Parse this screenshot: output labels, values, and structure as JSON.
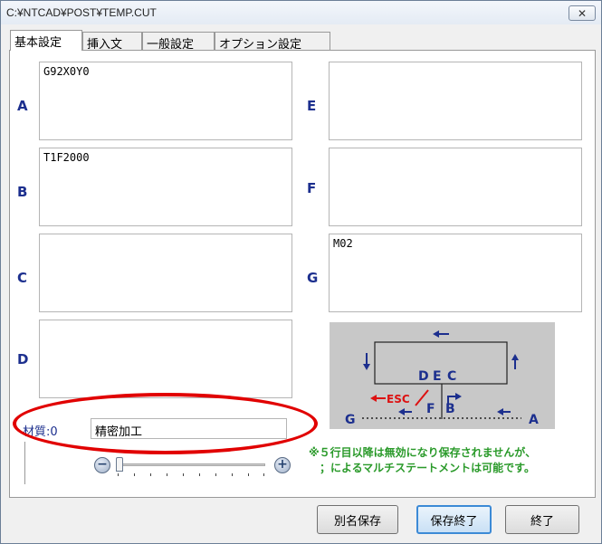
{
  "window": {
    "title": "C:¥NTCAD¥POST¥TEMP.CUT",
    "close_label": "✕"
  },
  "tabs": [
    {
      "label": "基本設定"
    },
    {
      "label": "挿入文"
    },
    {
      "label": "一般設定"
    },
    {
      "label": "オプション設定"
    }
  ],
  "slots": {
    "A": {
      "label": "A",
      "value": "G92X0Y0"
    },
    "B": {
      "label": "B",
      "value": "T1F2000"
    },
    "C": {
      "label": "C",
      "value": ""
    },
    "D": {
      "label": "D",
      "value": ""
    },
    "E": {
      "label": "E",
      "value": ""
    },
    "F": {
      "label": "F",
      "value": ""
    },
    "G": {
      "label": "G",
      "value": "M02"
    }
  },
  "diagram": {
    "labels": {
      "D": "D",
      "E": "E",
      "C": "C",
      "F": "F",
      "B": "B",
      "G": "G",
      "A": "A",
      "esc": "ESC"
    }
  },
  "material": {
    "label": "材質:",
    "index": "0",
    "value": "精密加工"
  },
  "note": {
    "line1": "※５行目以降は無効になり保存されませんが、",
    "line2": "；によるマルチステートメントは可能です。"
  },
  "buttons": {
    "save_as": "別名保存",
    "save_exit": "保存終了",
    "exit": "終了"
  },
  "colors": {
    "label_blue": "#1c2f8e",
    "note_green": "#2a9a2a",
    "ellipse_red": "#e10000"
  }
}
